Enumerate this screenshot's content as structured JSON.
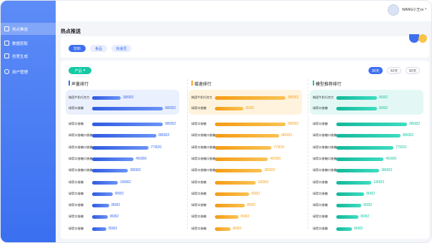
{
  "sidebar": {
    "items": [
      {
        "label": "热点推送",
        "icon": "edit-icon",
        "active": true
      },
      {
        "label": "数据获取",
        "icon": "checkbox-icon",
        "active": false
      },
      {
        "label": "创意生成",
        "icon": "image-icon",
        "active": false
      },
      {
        "label": "用户管理",
        "icon": "user-icon",
        "active": false
      }
    ]
  },
  "topbar": {
    "username": "WANG小王xx",
    "caret": "▾"
  },
  "page": {
    "title": "热点推送"
  },
  "tabs": [
    {
      "label": "饮料",
      "active": true
    },
    {
      "label": "食品",
      "active": false
    },
    {
      "label": "快递员",
      "active": false
    }
  ],
  "filter": {
    "label": "产品",
    "caret": "▾"
  },
  "periods": [
    {
      "label": "30天",
      "active": true
    },
    {
      "label": "60天",
      "active": false
    },
    {
      "label": "90天",
      "active": false
    }
  ],
  "colors": {
    "blue": "#3d6ff0",
    "orange": "#f5a623",
    "teal": "#15c9a5"
  },
  "columns": [
    {
      "title": "声量排行",
      "color": "blue",
      "highlight": [
        {
          "label": "微度牛奶巧克力",
          "value": "38082",
          "fill": 0.4
        },
        {
          "label": "绿箭口香糖",
          "value": "98082",
          "fill": 0.99
        }
      ],
      "rows": [
        {
          "label": "绿箭口香糖",
          "value": "98082",
          "fill": 0.99
        },
        {
          "label": "绿箭口香糖口香糖",
          "value": "88082",
          "fill": 0.9
        },
        {
          "label": "绿箭口香糖口香糖",
          "value": "77820",
          "fill": 0.79
        },
        {
          "label": "绿箭口香糖口香糖",
          "value": "45086",
          "fill": 0.58
        },
        {
          "label": "绿箭口香糖口香糖",
          "value": "38082",
          "fill": 0.5
        },
        {
          "label": "绿箭口香糖",
          "value": "18082",
          "fill": 0.36
        },
        {
          "label": "绿箭口香糖",
          "value": "8082",
          "fill": 0.29
        },
        {
          "label": "绿箭口香糖",
          "value": "8082",
          "fill": 0.24
        },
        {
          "label": "绿箭口香糖",
          "value": "8082",
          "fill": 0.22
        },
        {
          "label": "绿箭口香糖",
          "value": "8082",
          "fill": 0.2
        }
      ]
    },
    {
      "title": "增速排行",
      "color": "orange",
      "highlight": [
        {
          "label": "微度牛奶巧克力",
          "value": "98082",
          "fill": 0.99
        },
        {
          "label": "绿箭口香糖",
          "value": "8082",
          "fill": 0.4
        }
      ],
      "rows": [
        {
          "label": "绿箭口香糖",
          "value": "98082",
          "fill": 0.99
        },
        {
          "label": "绿箭口香糖口香糖",
          "value": "88082",
          "fill": 0.9
        },
        {
          "label": "绿箭口香糖口香糖",
          "value": "77820",
          "fill": 0.79
        },
        {
          "label": "绿箭口香糖口香糖",
          "value": "45086",
          "fill": 0.74
        },
        {
          "label": "绿箭口香糖口香糖",
          "value": "38082",
          "fill": 0.66
        },
        {
          "label": "绿箭口香糖",
          "value": "18082",
          "fill": 0.57
        },
        {
          "label": "绿箭口香糖",
          "value": "8082",
          "fill": 0.48
        },
        {
          "label": "绿箭口香糖",
          "value": "8082",
          "fill": 0.42
        },
        {
          "label": "绿箭口香糖",
          "value": "8082",
          "fill": 0.33
        },
        {
          "label": "绿箭口香糖",
          "value": "8082",
          "fill": 0.22
        }
      ]
    },
    {
      "title": "模型推荐排行",
      "color": "teal",
      "highlight": [
        {
          "label": "微度牛奶巧克力",
          "value": "8082",
          "fill": 0.57
        },
        {
          "label": "绿箭口香糖",
          "value": "8082",
          "fill": 0.57
        }
      ],
      "rows": [
        {
          "label": "绿箭口香糖",
          "value": "98082",
          "fill": 0.99
        },
        {
          "label": "绿箭口香糖口香糖",
          "value": "88082",
          "fill": 0.9
        },
        {
          "label": "绿箭口香糖口香糖",
          "value": "77820",
          "fill": 0.8
        },
        {
          "label": "绿箭口香糖口香糖",
          "value": "45086",
          "fill": 0.66
        },
        {
          "label": "绿箭口香糖口香糖",
          "value": "38082",
          "fill": 0.6
        },
        {
          "label": "绿箭口香糖",
          "value": "18082",
          "fill": 0.49
        },
        {
          "label": "绿箭口香糖",
          "value": "8082",
          "fill": 0.39
        },
        {
          "label": "绿箭口香糖",
          "value": "8082",
          "fill": 0.35
        },
        {
          "label": "绿箭口香糖",
          "value": "8082",
          "fill": 0.31
        },
        {
          "label": "绿箭口香糖",
          "value": "8082",
          "fill": 0.22
        }
      ]
    }
  ]
}
